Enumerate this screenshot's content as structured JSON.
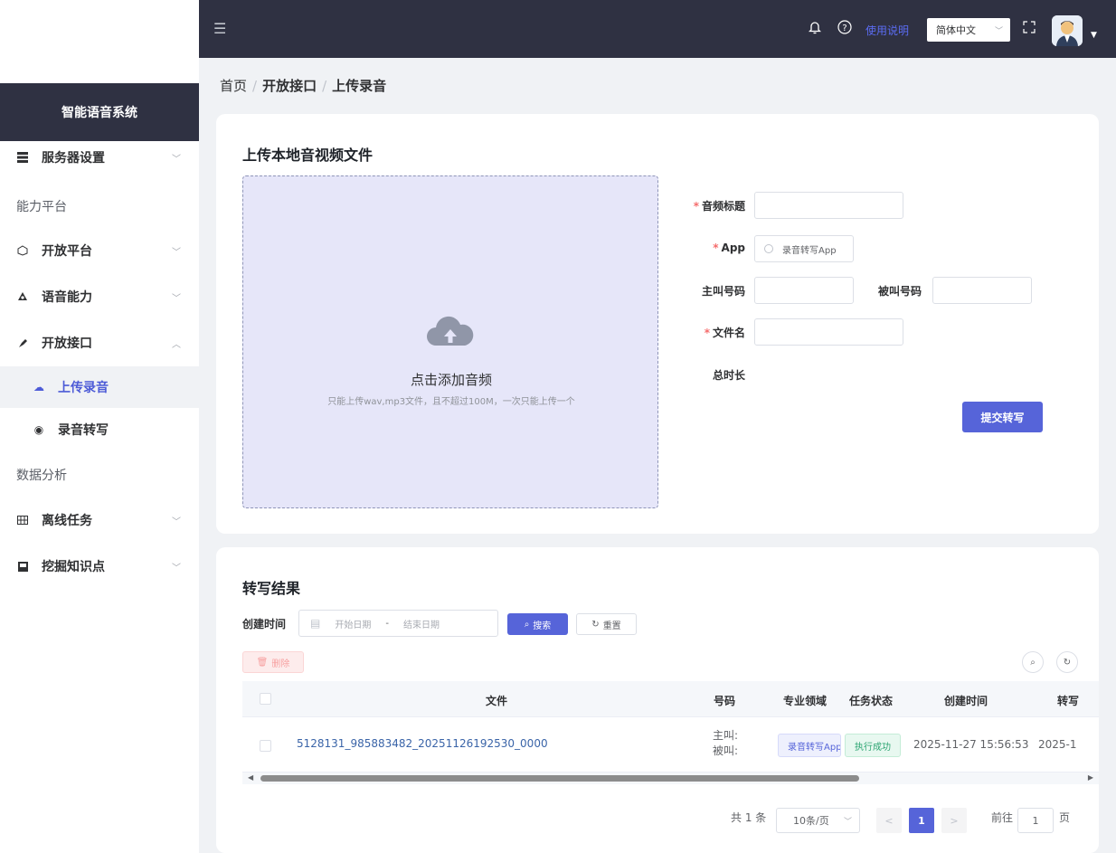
{
  "sidebar": {
    "brand": "智能语音系统",
    "items": [
      {
        "label": "服务器设置",
        "icon": "server-icon"
      },
      {
        "label": "开放平台",
        "icon": "platform-icon"
      },
      {
        "label": "语音能力",
        "icon": "voice-icon"
      },
      {
        "label": "开放接口",
        "icon": "api-icon"
      },
      {
        "label": "离线任务",
        "icon": "task-icon"
      },
      {
        "label": "挖掘知识点",
        "icon": "knowledge-icon"
      }
    ],
    "groups": [
      "能力平台",
      "数据分析"
    ],
    "sub_items": [
      {
        "label": "上传录音",
        "icon": "upload-icon",
        "active": true
      },
      {
        "label": "录音转写",
        "icon": "transcribe-icon",
        "active": false
      }
    ]
  },
  "topbar": {
    "help": "使用说明",
    "language": "简体中文"
  },
  "breadcrumb": {
    "home": "首页",
    "level2": "开放接口",
    "level3": "上传录音"
  },
  "upload_card": {
    "title": "上传本地音视频文件",
    "upload_title": "点击添加音频",
    "upload_hint": "只能上传wav,mp3文件，且不超过100M，一次只能上传一个",
    "labels": {
      "audio_title": "音频标题",
      "app": "App",
      "caller": "主叫号码",
      "callee": "被叫号码",
      "filename": "文件名",
      "duration": "总时长"
    },
    "app_option": "录音转写App",
    "submit": "提交转写"
  },
  "results_card": {
    "title": "转写结果",
    "filter_label": "创建时间",
    "start_placeholder": "开始日期",
    "end_placeholder": "结束日期",
    "search": "搜索",
    "reset": "重置",
    "delete": "删除",
    "columns": [
      "文件",
      "号码",
      "专业领域",
      "任务状态",
      "创建时间",
      "转写"
    ],
    "rows": [
      {
        "file": "5128131_985883482_20251126192530_0000",
        "caller": "主叫:",
        "callee": "被叫:",
        "domain": "录音转写App",
        "status": "执行成功",
        "created": "2025-11-27 15:56:53",
        "transcribed": "2025-1"
      }
    ],
    "pagination": {
      "total": "共 1 条",
      "page_size": "10条/页",
      "current_page": "1",
      "goto_label": "前往",
      "goto_value": "1",
      "page_suffix": "页"
    }
  },
  "colors": {
    "primary": "#5664d9",
    "dark": "#2f3142",
    "success": "#2ba471",
    "danger": "#f56c6c"
  }
}
